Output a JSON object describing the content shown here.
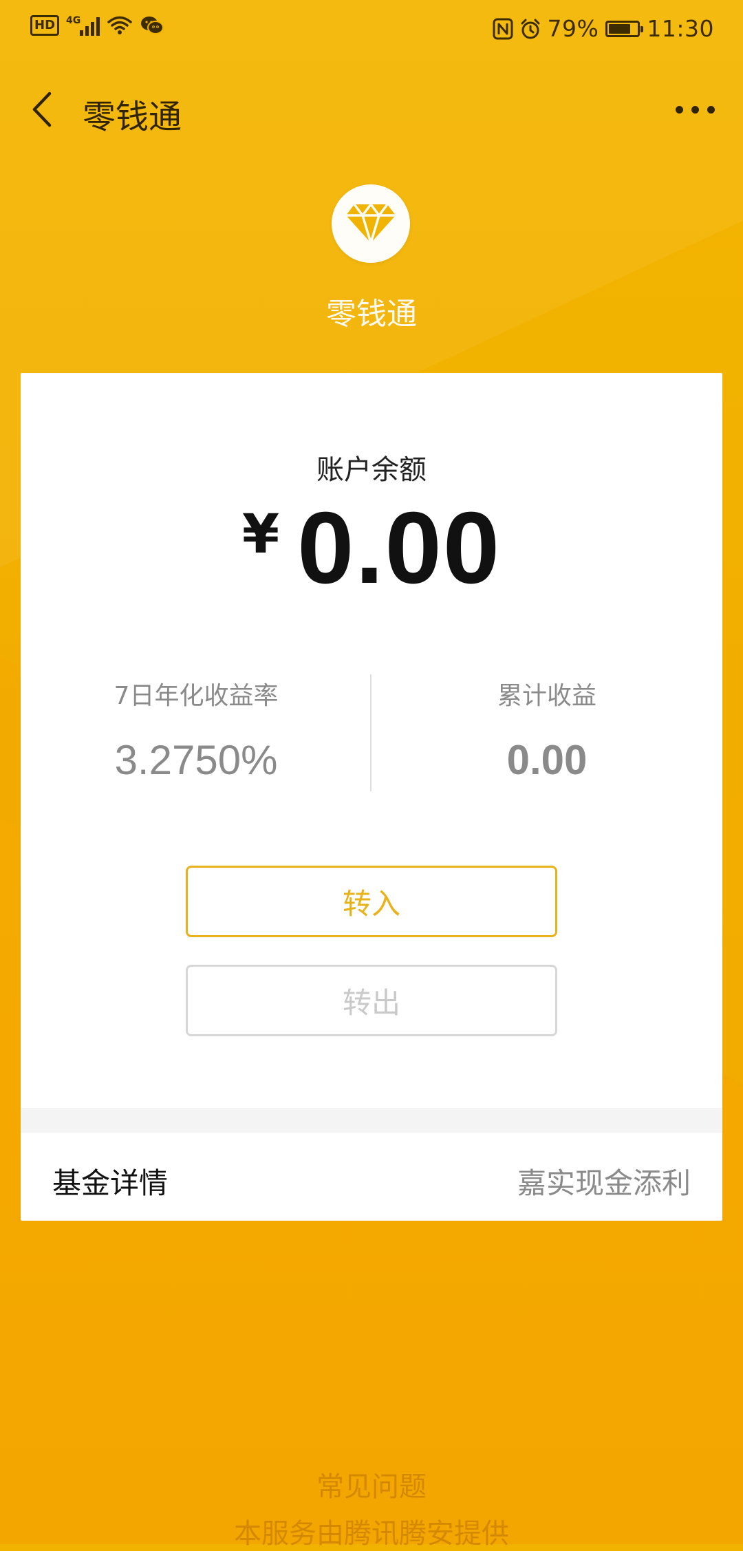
{
  "status_bar": {
    "hd": "HD",
    "network": "4G",
    "battery_percent": "79%",
    "battery_level": 0.79,
    "time": "11:30",
    "icons": [
      "hd-icon",
      "signal-icon",
      "wifi-icon",
      "wechat-icon",
      "nfc-icon",
      "alarm-icon",
      "battery-icon"
    ]
  },
  "nav": {
    "title": "零钱通",
    "back_icon": "chevron-left-icon",
    "more_icon": "more-dots-icon"
  },
  "product": {
    "icon": "diamond-icon",
    "name": "零钱通"
  },
  "account": {
    "balance_label": "账户余额",
    "currency_symbol": "¥",
    "balance": "0.00"
  },
  "stats": {
    "yield_label": "7日年化收益率",
    "yield_value": "3.2750%",
    "earnings_label": "累计收益",
    "earnings_value": "0.00"
  },
  "actions": {
    "transfer_in": "转入",
    "transfer_out": "转出"
  },
  "fund": {
    "label": "基金详情",
    "value": "嘉实现金添利"
  },
  "footer": {
    "faq": "常见问题",
    "provider": "本服务由腾讯腾安提供"
  },
  "colors": {
    "background": "#f2b300",
    "accent": "#e8b21a",
    "card": "#ffffff",
    "muted_text": "#8a8a8a"
  }
}
